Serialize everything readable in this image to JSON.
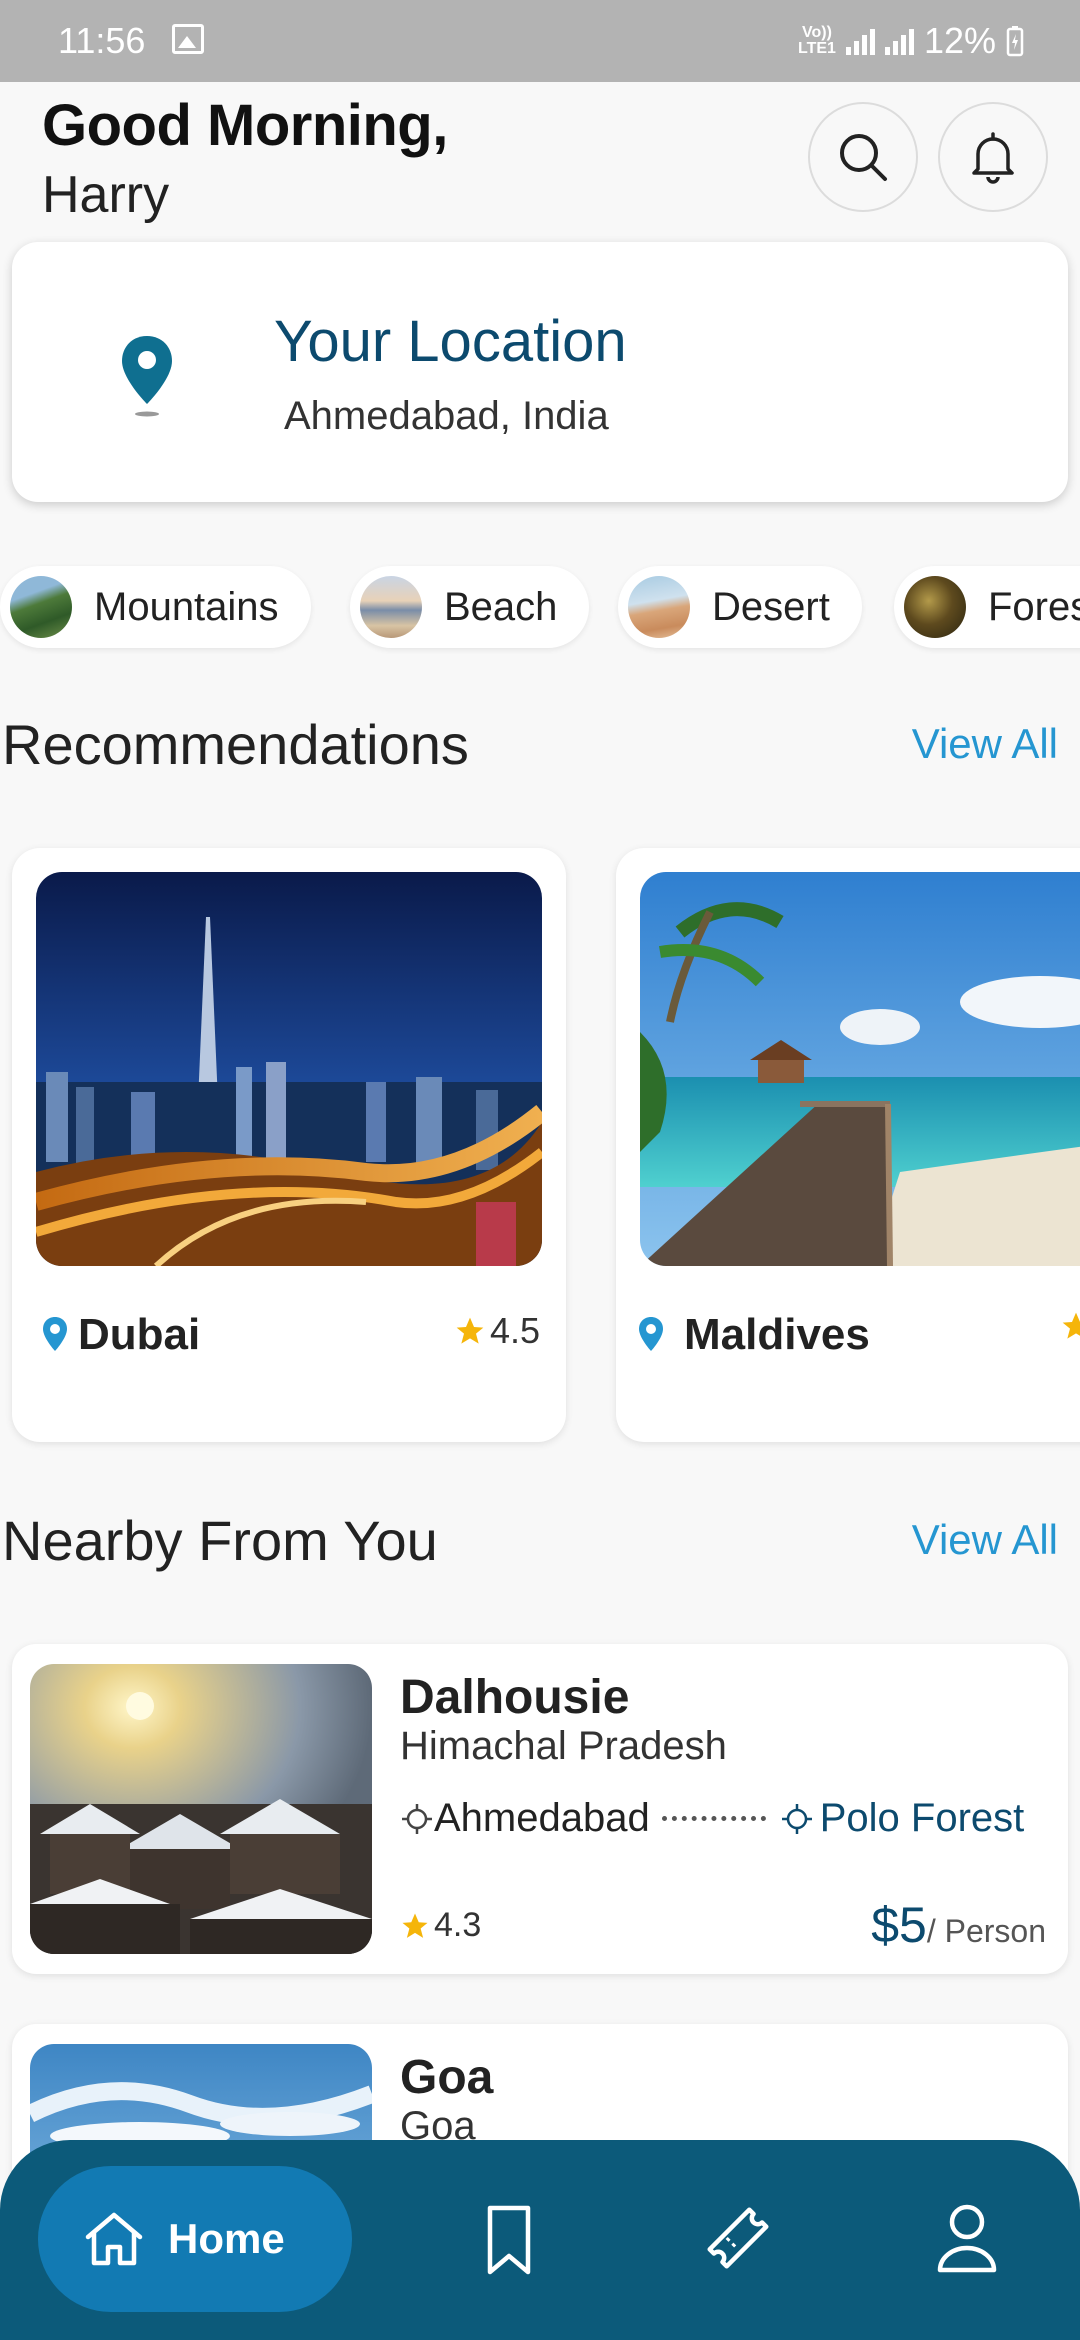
{
  "status_bar": {
    "time": "11:56",
    "network": "Vo)) LTE1",
    "battery": "12%"
  },
  "greeting": {
    "hello": "Good Morning,",
    "name": "Harry"
  },
  "location": {
    "title": "Your Location",
    "value": "Ahmedabad, India"
  },
  "categories": [
    {
      "label": "Mountains",
      "icon": "mountains-thumbnail"
    },
    {
      "label": "Beach",
      "icon": "beach-thumbnail"
    },
    {
      "label": "Desert",
      "icon": "desert-thumbnail"
    },
    {
      "label": "Fores",
      "icon": "forest-thumbnail"
    }
  ],
  "recommendations": {
    "title": "Recommendations",
    "view_all": "View All",
    "items": [
      {
        "place": "Dubai",
        "rating": "4.5"
      },
      {
        "place": "Maldives",
        "rating": ""
      }
    ]
  },
  "nearby": {
    "title": "Nearby From You",
    "view_all": "View All",
    "items": [
      {
        "name": "Dalhousie",
        "state": "Himachal Pradesh",
        "from": "Ahmedabad",
        "to": "Polo Forest",
        "rating": "4.3",
        "price": "$5",
        "per": "/ Person"
      },
      {
        "name": "Goa",
        "state": "Goa"
      }
    ]
  },
  "nav": {
    "home_label": "Home"
  },
  "colors": {
    "primary": "#0c4a6e",
    "accent": "#2596d1",
    "nav_bg": "#0c5a7a",
    "star": "#f5b50a"
  }
}
